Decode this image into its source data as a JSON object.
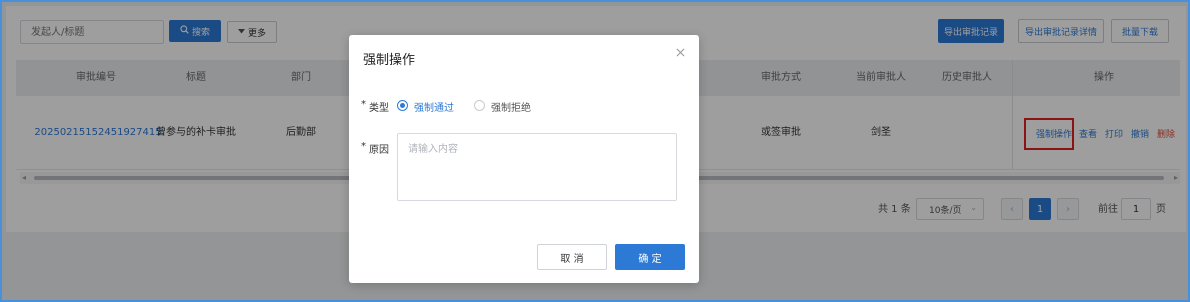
{
  "toolbar": {
    "search_placeholder": "发起人/标题",
    "search_icon": "search-icon",
    "search_label": "搜索",
    "more_icon": "caret-down-icon",
    "more_label": "更多",
    "export_label": "导出审批记录",
    "export_detail_label": "导出审批记录详情",
    "batch_download_label": "批量下载"
  },
  "table": {
    "headers": {
      "id": "审批编号",
      "title": "标题",
      "dept": "部门",
      "method": "审批方式",
      "current_approver": "当前审批人",
      "history_approver": "历史审批人",
      "actions": "操作"
    },
    "rows": [
      {
        "id": "20250215152451927415",
        "title": "曾参与的补卡审批",
        "dept": "后勤部",
        "method": "或签审批",
        "current_approver": "剑圣",
        "history_approver": "",
        "actions": [
          "强制操作",
          "查看",
          "打印",
          "撤销",
          "删除"
        ]
      }
    ]
  },
  "pagination": {
    "total": "共 1 条",
    "page_size": "10条/页",
    "prev_icon": "chevron-left-icon",
    "current_page": "1",
    "next_icon": "chevron-right-icon",
    "goto_label": "前往",
    "goto_value": "1",
    "page_suffix": "页"
  },
  "dialog": {
    "title": "强制操作",
    "close_icon": "close-icon",
    "type_label": "类型",
    "type_options": [
      "强制通过",
      "强制拒绝"
    ],
    "type_selected": "强制通过",
    "reason_label": "原因",
    "reason_placeholder": "请输入内容",
    "required_mark": "*",
    "cancel_label": "取 消",
    "confirm_label": "确 定"
  },
  "colors": {
    "primary": "#2d7ad6",
    "danger": "#e04a3b",
    "highlight_box": "#e02020",
    "frame_border": "#4a8fd9"
  }
}
